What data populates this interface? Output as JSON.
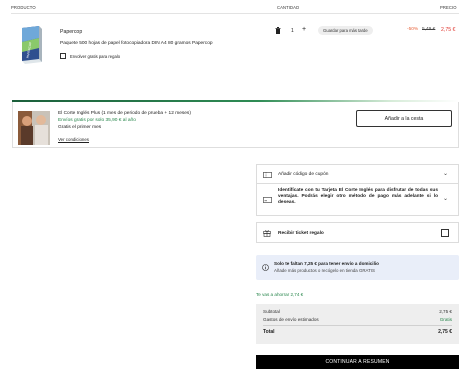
{
  "header": {
    "product_col": "PRODUCTO",
    "qty_col": "CANTIDAD",
    "price_col": "PRECIO"
  },
  "item": {
    "brand": "Papercop",
    "description": "Paquete 500 hojas de papel fotocopiadora DIN A4 80 gramos Papercop",
    "gift_wrap_label": "Envolver gratis para regalo",
    "quantity": "1",
    "plus_symbol": "+",
    "save_later_label": "Guardar para más tarde",
    "discount": "-50%",
    "old_price": "5,49 €",
    "new_price": "2,75 €"
  },
  "plus_offer": {
    "title": "El Corte Inglés Plus (1 mes de periodo de prueba + 12 meses)",
    "shipping": "Envíos gratis por solo 35,90 € al año",
    "first_month": "Gratis el primer mes",
    "conditions_link": "Ver condiciones",
    "add_to_cart_label": "Añadir a la cesta"
  },
  "panels": {
    "coupon_label": "Añadir código de cupón",
    "card_text": "Identifícate con tu Tarjeta El Corte Inglés para disfrutar de todas sus ventajas. Podrás elegir otro método de pago más adelante si lo deseas.",
    "gift_ticket_label": "Recibir ticket regalo"
  },
  "info": {
    "bold": "Solo te faltan 7,25 € para tener envío a domicilio",
    "text": "Añade más productos o recógelo en tienda GRATIS"
  },
  "savings": "Te vas a ahorrar 2,74 €",
  "summary": {
    "subtotal_label": "Subtotal",
    "subtotal_value": "2,75 €",
    "shipping_label": "Gastos de envío estimados",
    "shipping_value": "Gratis",
    "total_label": "Total",
    "total_value": "2,75 €"
  },
  "cta_label": "CONTINUAR A RESUMEN",
  "colors": {
    "discount": "#e8643c",
    "price": "#e0322b",
    "green": "#26854a",
    "info_bg": "#e9eef9"
  }
}
